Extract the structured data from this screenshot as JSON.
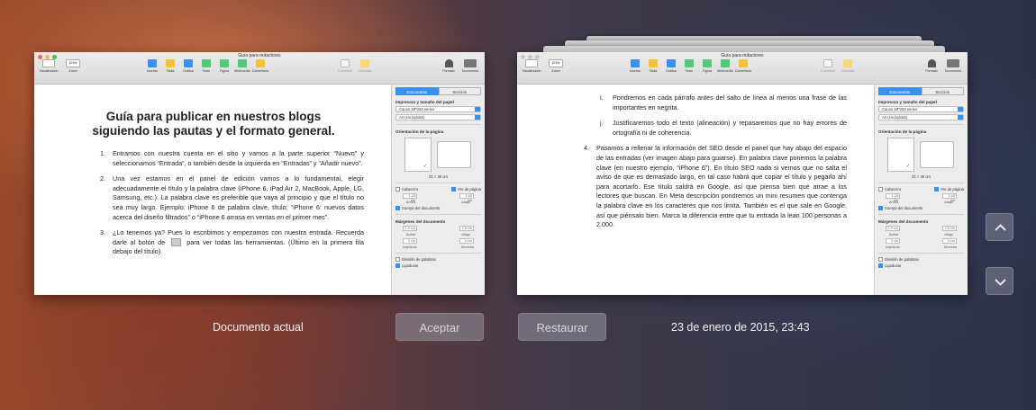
{
  "colors": {
    "accent": "#3b8ff0",
    "close": "#fc605c",
    "minimize": "#fdbc40",
    "zoom": "#34c84a"
  },
  "window": {
    "title": "Guía para redactores",
    "toolbar_left": [
      {
        "label": "Visualización",
        "icon": "view-icon"
      },
      {
        "label": "Zoom",
        "value": "101%",
        "icon": "zoom-icon"
      }
    ],
    "toolbar_center": [
      {
        "label": "Insertar",
        "icon": "insert-icon",
        "color": "#3b8ff0"
      },
      {
        "label": "Tabla",
        "icon": "table-icon",
        "color": "#f3c33a"
      },
      {
        "label": "Gráfica",
        "icon": "chart-icon",
        "color": "#3b8ff0"
      },
      {
        "label": "Texto",
        "icon": "text-icon",
        "color": "#52c878"
      },
      {
        "label": "Figura",
        "icon": "shape-icon",
        "color": "#52c878"
      },
      {
        "label": "Multimedia",
        "icon": "media-icon",
        "color": "#52c878"
      },
      {
        "label": "Comentario",
        "icon": "comment-icon",
        "color": "#f3c33a"
      }
    ],
    "toolbar_share": [
      {
        "label": "Compartir",
        "icon": "share-icon"
      },
      {
        "label": "Consejos",
        "icon": "tips-icon"
      }
    ],
    "toolbar_right": [
      {
        "label": "Formato",
        "icon": "format-icon"
      },
      {
        "label": "Documento",
        "icon": "document-icon"
      }
    ]
  },
  "sidebar": {
    "tab_document": "Documento",
    "tab_section": "Sección",
    "printer_heading": "Impresora y tamaño del papel",
    "printer_value": "Canon MP250 series",
    "paper_value": "A4 (sin bordes)",
    "orientation_heading": "Orientación de la página",
    "page_size": "21 × 30 cm",
    "header_label": "Cabecera",
    "footer_label": "Pie de página",
    "header_value": "1,25 cm",
    "footer_value": "1,25 cm",
    "above_label": "Arriba",
    "below_label": "Abajo",
    "body_label": "Cuerpo del documento",
    "margins_heading": "Márgenes del documento",
    "margin_top": "1,9 cm",
    "margin_bottom": "2,5 cm",
    "margin_left": "3 cm",
    "margin_right": "3 cm",
    "top_label": "Arriba",
    "bottom_label": "Abajo",
    "left_label": "Izquierda",
    "right_label": "Derecha",
    "hyphen_label": "División de palabras",
    "ligature_label": "Ligaduras"
  },
  "current_doc": {
    "title": "Guía para publicar en nuestros blogs siguiendo las pautas y el formato general.",
    "items": [
      {
        "num": "1.",
        "text": "Entramos con nuestra cuenta en el sitio y vamos a la parte superior “Nuevo” y seleccionamos “Entrada”, o también desde la izquierda en “Entradas” y “Añadir nuevo”."
      },
      {
        "num": "2.",
        "text": "Una vez estamos en el panel de edición vamos a lo fundamental, elegir adecuadamente el título y la palabra clave (iPhone 6, iPad Air 2, MacBook, Apple, LG, Samsung, etc.). La palabra clave es preferible que vaya al principio y que el título no sea muy largo. Ejemplo: iPhone 6 de palabra clave, título: “iPhone 6: nuevos datos acerca del diseño filtrados” o “iPhone 6 arrasa en ventas en el primer mes”."
      },
      {
        "num": "3.",
        "text": "¿Lo tenemos ya? Pues lo escribimos y empezamos con nuestra entrada. Recuerda darle al botón de",
        "text_after": "para ver todas las herramientas. (Último en la primera fila debajo del título)."
      }
    ]
  },
  "version_doc": {
    "items_roman": [
      {
        "num": "i.",
        "text": "Pondremos en cada párrafo antes del salto de línea al menos una frase de las importantes en negrita."
      },
      {
        "num": "j.",
        "text": "Justificaremos todo el texto (alineación) y repasaremos que no hay errores de ortografía ni de coherencia."
      }
    ],
    "item4": {
      "num": "4.",
      "text": "Pasamos a rellenar la información del SEO desde el panel que hay abajo del espacio de las entradas (ver imagen abajo para guiarse). En palabra clave ponemos la palabra clave (en nuestro ejemplo, “iPhone 6”). En título SEO nada si vemos que no salta el aviso de que es demasiado largo, en tal caso habrá que copiar el título y pegarlo ahí para acortarlo. Ese título saldrá en Google, así que piensa bien qué atrae a los lectores que buscan. En Meta descripción pondremos un mini resumen que contenga la palabra clave en los caracteres que nos limita. También es el que sale en Google, así que piénsalo bien. Marca la diferencia entre que tu entrada la lean 100 personas a 2.000."
    }
  },
  "bottom": {
    "current_label": "Documento actual",
    "accept_button": "Aceptar",
    "restore_button": "Restaurar",
    "version_date": "23 de enero de 2015, 23:43"
  }
}
